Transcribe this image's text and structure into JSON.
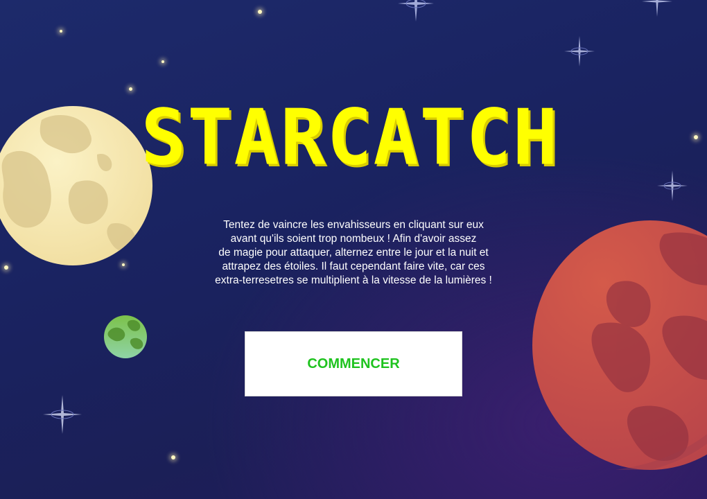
{
  "game": {
    "title": "STARCATCH",
    "description_lines": [
      "Tentez de vaincre les envahisseurs en cliquant sur eux",
      "avant qu'ils soient trop nombeux ! Afin d'avoir assez",
      "de magie pour attaquer, alternez entre le jour et la nuit et",
      "attrapez des étoiles. Il faut cependant faire vite, car ces",
      "extra-terresetres se multiplient à la vitesse de la lumières !"
    ],
    "start_button_label": "COMMENCER"
  },
  "colors": {
    "title": "#ffff00",
    "button_text": "#1fc31f",
    "button_bg": "#ffffff",
    "background": "#1d2a6b",
    "moon_planet": "#f6e8b1",
    "green_planet": "#7cc24a",
    "red_planet": "#c8504a"
  },
  "icons": {
    "moon_planet": "moon-planet-icon",
    "green_planet": "green-planet-icon",
    "red_planet": "red-planet-icon",
    "star": "star-icon",
    "sparkle": "sparkle-star-icon"
  }
}
